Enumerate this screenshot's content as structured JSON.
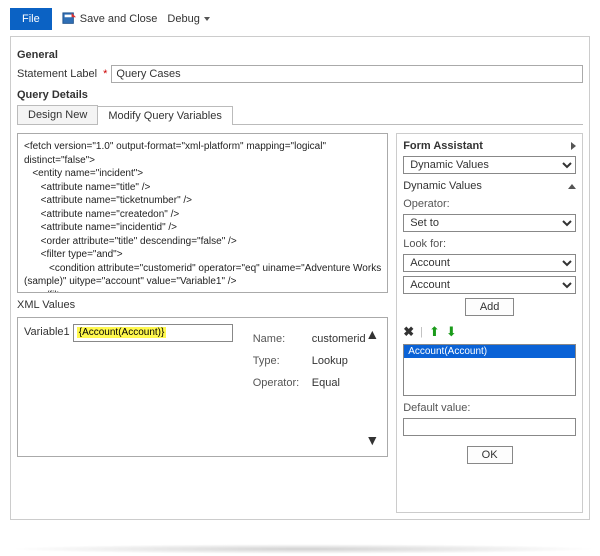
{
  "toolbar": {
    "file_label": "File",
    "save_close_label": "Save and Close",
    "debug_label": "Debug"
  },
  "general": {
    "title": "General",
    "statement_label_text": "Statement Label",
    "statement_value": "Query Cases"
  },
  "query_details": {
    "title": "Query Details",
    "tabs": {
      "design_new": "Design New",
      "modify_vars": "Modify Query Variables"
    },
    "fetchxml": "<fetch version=\"1.0\" output-format=\"xml-platform\" mapping=\"logical\"\ndistinct=\"false\">\n   <entity name=\"incident\">\n      <attribute name=\"title\" />\n      <attribute name=\"ticketnumber\" />\n      <attribute name=\"createdon\" />\n      <attribute name=\"incidentid\" />\n      <order attribute=\"title\" descending=\"false\" />\n      <filter type=\"and\">\n         <condition attribute=\"customerid\" operator=\"eq\" uiname=\"Adventure Works\n(sample)\" uitype=\"account\" value=\"Variable1\" />\n      </filter>\n   </entity>\n</fetch>",
    "xml_values_title": "XML Values",
    "variable_label": "Variable1",
    "variable_slug": "{Account(Account)}",
    "meta": {
      "name_k": "Name:",
      "name_v": "customerid",
      "type_k": "Type:",
      "type_v": "Lookup",
      "op_k": "Operator:",
      "op_v": "Equal"
    }
  },
  "form_assistant": {
    "title": "Form Assistant",
    "top_select": "Dynamic Values",
    "section": "Dynamic Values",
    "operator_label": "Operator:",
    "operator_value": "Set to",
    "lookfor_label": "Look for:",
    "lookfor_value1": "Account",
    "lookfor_value2": "Account",
    "add_label": "Add",
    "list_item": "Account(Account)",
    "default_label": "Default value:",
    "ok_label": "OK"
  }
}
